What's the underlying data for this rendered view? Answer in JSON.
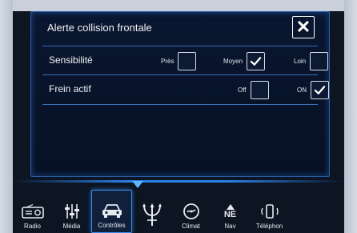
{
  "dialog": {
    "title": "Alerte collision frontale",
    "close_label": "✕"
  },
  "rows": [
    {
      "label": "Sensibilité",
      "options": [
        {
          "label": "Près",
          "checked": false
        },
        {
          "label": "Moyen",
          "checked": true
        },
        {
          "label": "Loin",
          "checked": false
        }
      ]
    },
    {
      "label": "Frein actif",
      "options": [
        {
          "label": "Off",
          "checked": false
        },
        {
          "label": "ON",
          "checked": true
        }
      ]
    }
  ],
  "nav": [
    {
      "label": "Radio",
      "icon": "radio-icon",
      "active": false
    },
    {
      "label": "Média",
      "icon": "media-icon",
      "active": false
    },
    {
      "label": "Contrôles",
      "icon": "car-icon",
      "active": true
    },
    {
      "label": "",
      "icon": "trident-logo-icon",
      "active": false
    },
    {
      "label": "Climat",
      "icon": "climate-icon",
      "active": false
    },
    {
      "label": "Nav",
      "icon": "compass-ne-icon",
      "active": false,
      "badge": "NE"
    },
    {
      "label": "Téléphon",
      "icon": "phone-icon",
      "active": false
    }
  ],
  "colors": {
    "accent": "#2b80e6",
    "border": "#3b6fb8"
  }
}
